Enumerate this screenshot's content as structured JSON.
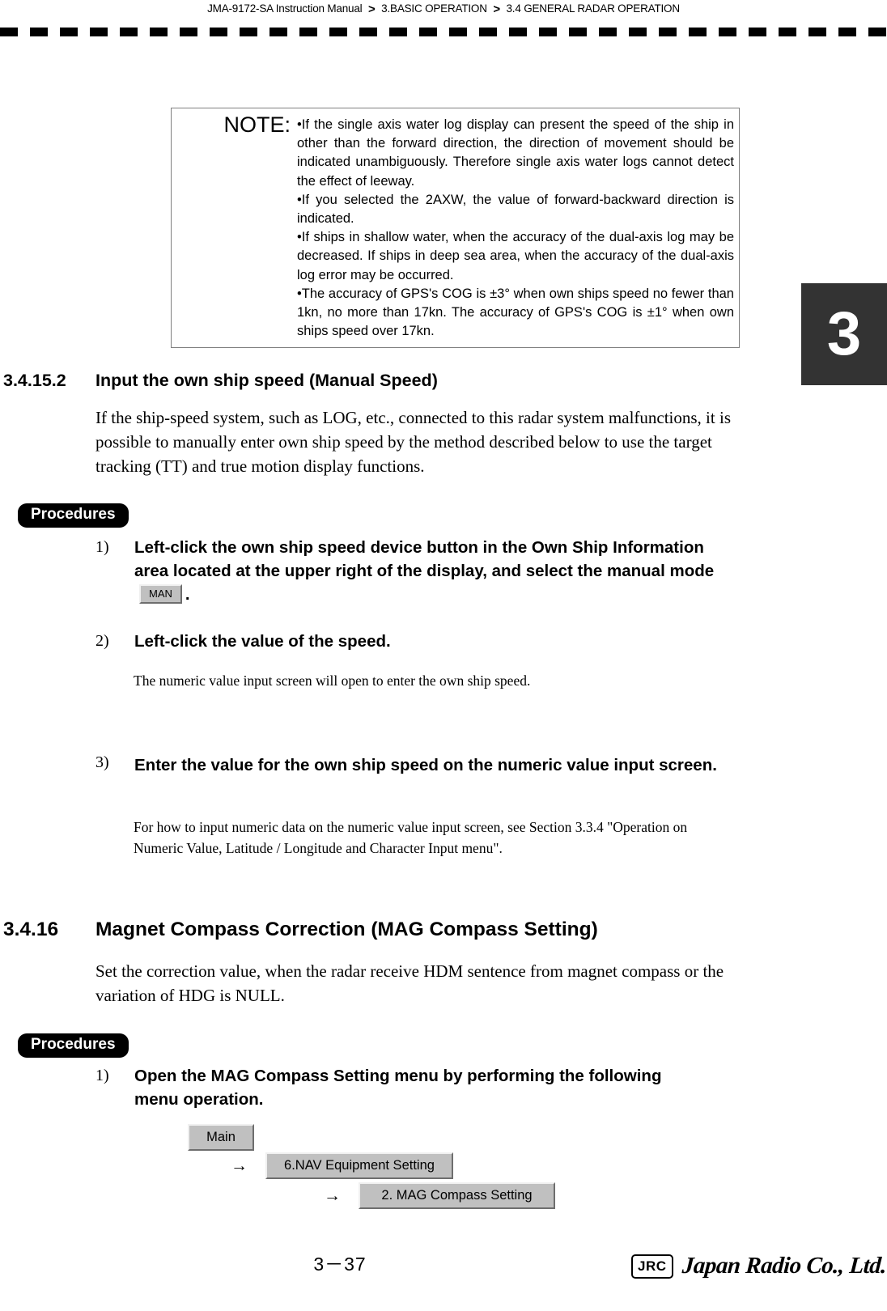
{
  "header": {
    "manual": "JMA-9172-SA Instruction Manual",
    "separator": ">",
    "chapter": "3.BASIC OPERATION",
    "section": "3.4  GENERAL RADAR OPERATION"
  },
  "chapter_tab": {
    "number": "3"
  },
  "note": {
    "label": "NOTE:",
    "items": [
      "If the single axis water log display can present the speed of the ship in other than the forward direction, the direction of movement should be indicated unambiguously. Therefore single axis water logs cannot detect the effect of leeway.",
      "If you selected the 2AXW, the value of forward-backward direction is indicated.",
      "If ships in shallow water, when the accuracy of the dual-axis log may be decreased. If ships in deep sea area, when the accuracy of the dual-axis log error may be occurred.",
      "The accuracy of GPS's COG is ±3° when own ships speed no fewer than 1kn, no more than 17kn. The accuracy of GPS's COG is ±1°  when own ships speed over 17kn."
    ]
  },
  "section_3_4_15_2": {
    "number": "3.4.15.2",
    "title": "Input the own ship speed (Manual Speed)",
    "intro": "If the ship-speed system, such as LOG, etc., connected to this radar system malfunctions, it is possible to manually enter own ship speed by the method described below to use the target tracking (TT) and true motion display functions.",
    "procedures_label": "Procedures",
    "steps": [
      {
        "number": "1)",
        "text_before_button": "Left-click the own ship speed device button in the Own Ship Information area located at the upper right of the display, and select the manual mode",
        "button_label": "MAN",
        "text_after_button": "."
      },
      {
        "number": "2)",
        "text": "Left-click the value of the speed.",
        "note": "The numeric value input screen will open to enter the own ship speed."
      },
      {
        "number": "3)",
        "text": "Enter the value for the own ship speed on the numeric value input screen.",
        "note": "For how to input numeric data on the numeric value input screen, see Section 3.3.4 \"Operation on Numeric Value, Latitude / Longitude and Character Input menu\"."
      }
    ]
  },
  "section_3_4_16": {
    "number": "3.4.16",
    "title": "Magnet Compass Correction (MAG Compass Setting)",
    "intro": "Set the correction value, when the radar receive HDM sentence from magnet compass or the variation of HDG is NULL.",
    "procedures_label": "Procedures",
    "step": {
      "number": "1)",
      "text": "Open the MAG Compass Setting menu by performing the following menu operation."
    },
    "menu_path": {
      "arrow": "→",
      "buttons": [
        "Main",
        "6.NAV Equipment Setting",
        "2. MAG Compass Setting"
      ]
    }
  },
  "footer": {
    "page_number": "3－37",
    "logo_mark": "JRC",
    "logo_name": "Japan Radio Co., Ltd."
  }
}
